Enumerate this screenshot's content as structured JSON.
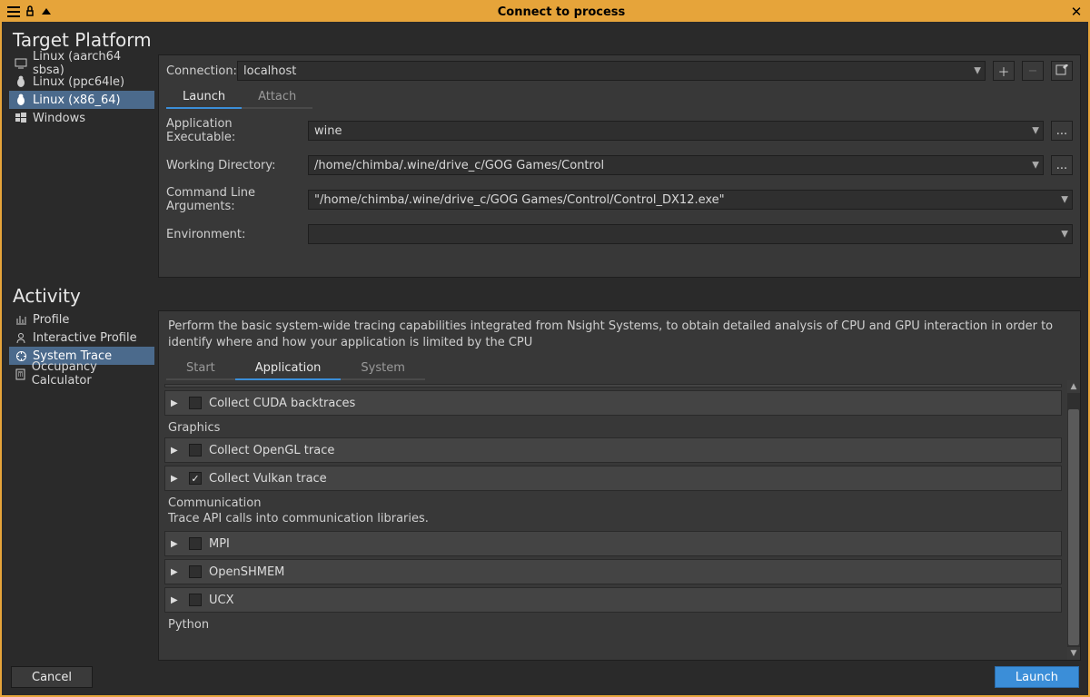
{
  "title": "Connect to process",
  "section_target": "Target Platform",
  "section_activity": "Activity",
  "platforms": [
    {
      "label": "Linux (aarch64 sbsa)",
      "icon": "monitor"
    },
    {
      "label": "Linux (ppc64le)",
      "icon": "penguin"
    },
    {
      "label": "Linux (x86_64)",
      "icon": "penguin"
    },
    {
      "label": "Windows",
      "icon": "windows"
    }
  ],
  "connection_label": "Connection:",
  "connection_value": "localhost",
  "conn_tabs": {
    "launch": "Launch",
    "attach": "Attach"
  },
  "form": {
    "exec_label": "Application Executable:",
    "exec_value": "wine",
    "wd_label": "Working Directory:",
    "wd_value": "/home/chimba/.wine/drive_c/GOG Games/Control",
    "args_label": "Command Line Arguments:",
    "args_value": "\"/home/chimba/.wine/drive_c/GOG Games/Control/Control_DX12.exe\"",
    "env_label": "Environment:",
    "env_value": ""
  },
  "activities": [
    {
      "label": "Profile",
      "icon": "chart"
    },
    {
      "label": "Interactive Profile",
      "icon": "person"
    },
    {
      "label": "System Trace",
      "icon": "target"
    },
    {
      "label": "Occupancy Calculator",
      "icon": "calc"
    }
  ],
  "activity_desc": "Perform the basic system-wide tracing capabilities integrated from Nsight Systems, to obtain detailed analysis of CPU and GPU interaction in order to identify where and how your application is limited by the CPU",
  "act_tabs": {
    "start": "Start",
    "application": "Application",
    "system": "System"
  },
  "options": {
    "top_item": {
      "label": "Collect CUDA backtraces",
      "checked": false
    },
    "graphics_header": "Graphics",
    "graphics": [
      {
        "label": "Collect OpenGL trace",
        "checked": false
      },
      {
        "label": "Collect Vulkan trace",
        "checked": true
      }
    ],
    "comm_header": "Communication",
    "comm_sub": "Trace API calls into communication libraries.",
    "comm": [
      {
        "label": "MPI",
        "checked": false
      },
      {
        "label": "OpenSHMEM",
        "checked": false
      },
      {
        "label": "UCX",
        "checked": false
      }
    ],
    "python_header": "Python"
  },
  "buttons": {
    "cancel": "Cancel",
    "launch": "Launch"
  },
  "ellipsis": "..."
}
